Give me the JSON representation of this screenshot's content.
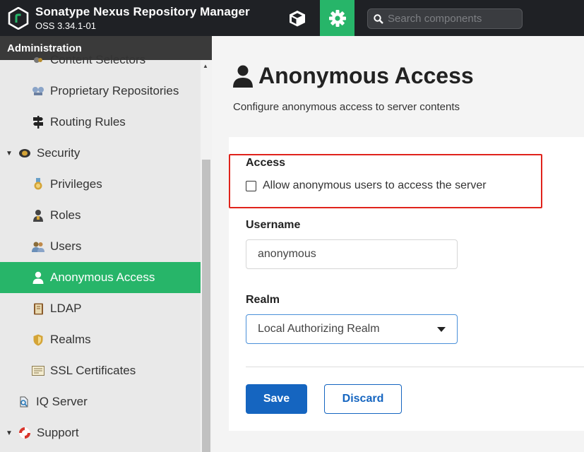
{
  "header": {
    "app_title": "Sonatype Nexus Repository Manager",
    "version": "OSS 3.34.1-01",
    "browse_icon": "cube-icon",
    "admin_icon": "gear-icon",
    "search_placeholder": "Search components"
  },
  "sidebar": {
    "title": "Administration",
    "items": [
      {
        "label": "Content Selectors",
        "icon": "selector-icon"
      },
      {
        "label": "Proprietary Repositories",
        "icon": "proprietary-icon"
      },
      {
        "label": "Routing Rules",
        "icon": "signpost-icon"
      },
      {
        "label": "Security",
        "icon": "badge-icon",
        "expanded": true
      },
      {
        "label": "Privileges",
        "icon": "medal-icon"
      },
      {
        "label": "Roles",
        "icon": "role-icon"
      },
      {
        "label": "Users",
        "icon": "users-icon"
      },
      {
        "label": "Anonymous Access",
        "icon": "user-icon",
        "active": true
      },
      {
        "label": "LDAP",
        "icon": "book-icon"
      },
      {
        "label": "Realms",
        "icon": "shield-icon"
      },
      {
        "label": "SSL Certificates",
        "icon": "certificate-icon"
      },
      {
        "label": "IQ Server",
        "icon": "iq-icon"
      },
      {
        "label": "Support",
        "icon": "lifebuoy-icon",
        "expanded": true
      }
    ]
  },
  "main": {
    "title": "Anonymous Access",
    "description": "Configure anonymous access to server contents",
    "access_label": "Access",
    "allow_label": "Allow anonymous users to access the server",
    "allow_checked": false,
    "username_label": "Username",
    "username_value": "anonymous",
    "realm_label": "Realm",
    "realm_value": "Local Authorizing Realm",
    "save_label": "Save",
    "discard_label": "Discard"
  },
  "colors": {
    "accent_green": "#27b569",
    "primary_blue": "#1565c0",
    "highlight_red": "#e0231c",
    "header_bg": "#1f2125"
  }
}
